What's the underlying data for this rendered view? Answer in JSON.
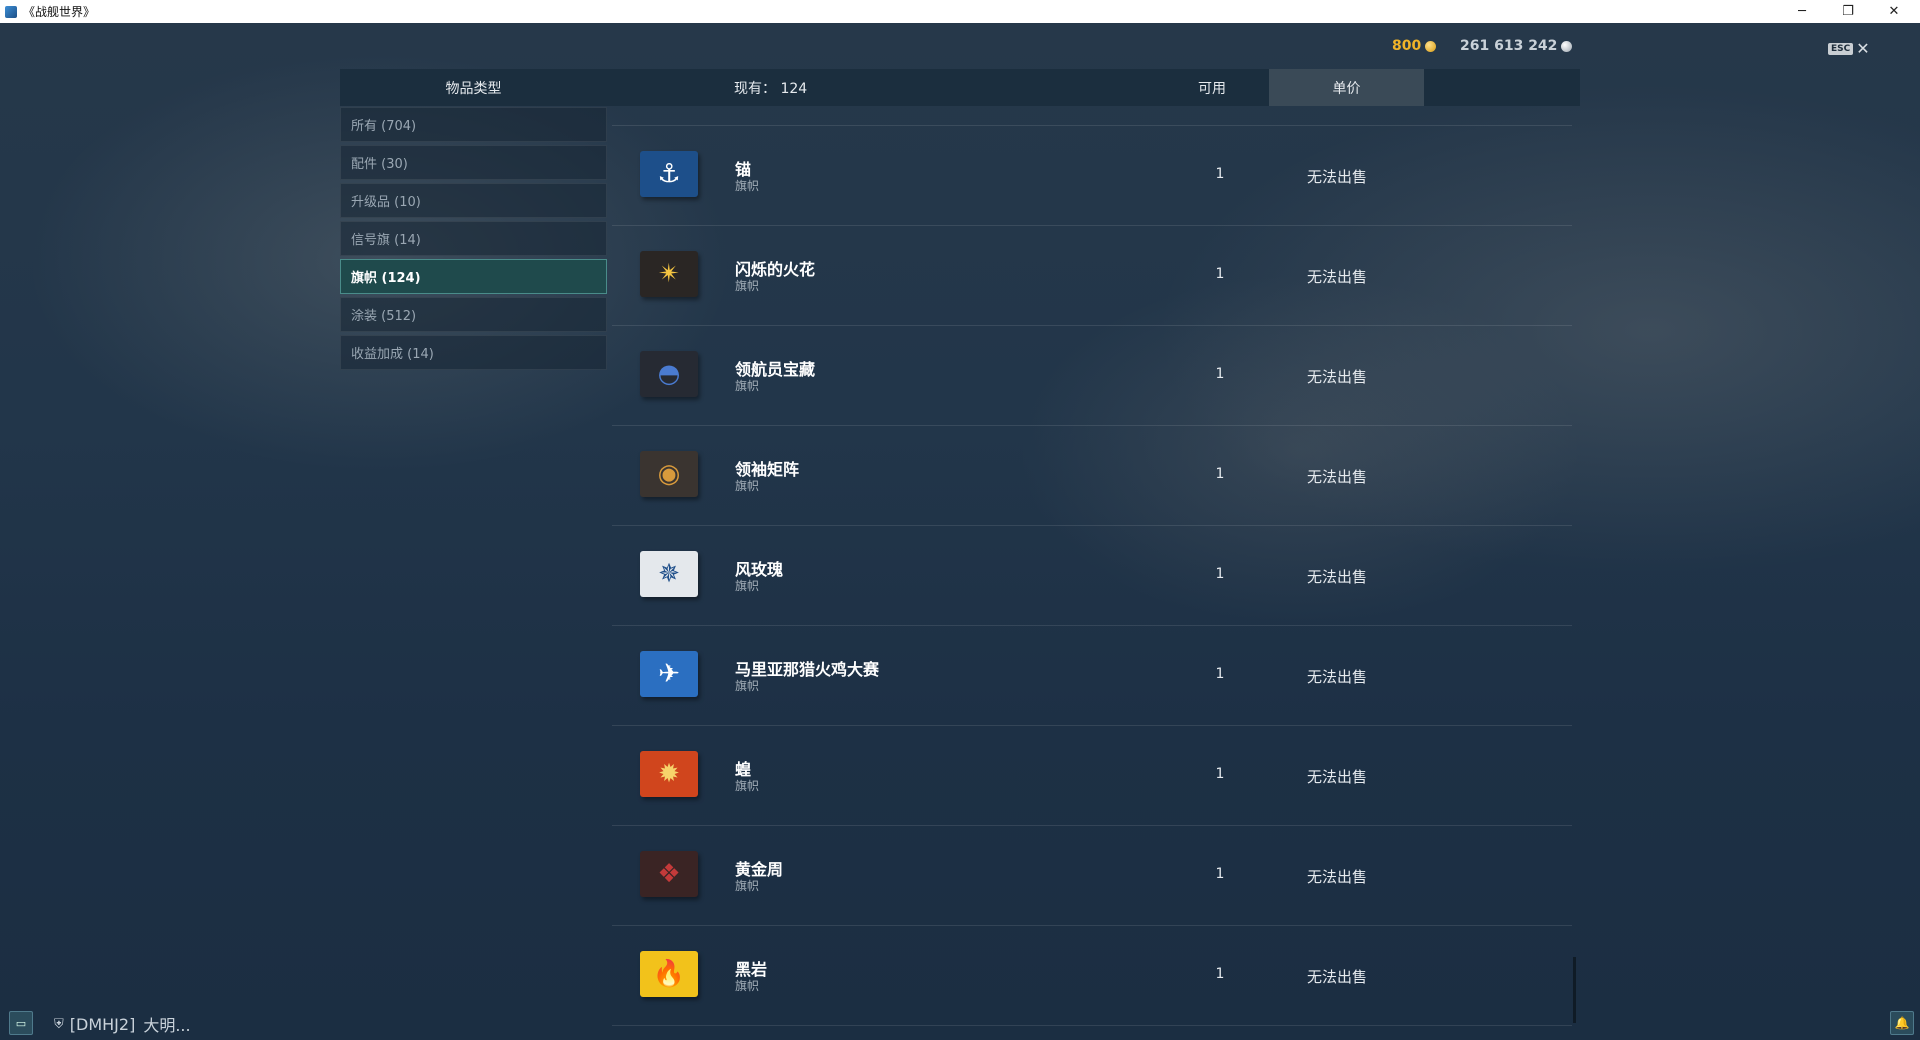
{
  "window": {
    "title": "《战舰世界》",
    "minimize": "─",
    "restore": "❐",
    "close": "✕"
  },
  "currencies": {
    "doubloons": "800",
    "doubloons_color": "#f0b429",
    "credits": "261 613 242",
    "credits_color": "#c9d1d8"
  },
  "esc": {
    "badge": "ESC",
    "close": "✕"
  },
  "header": {
    "type_label": "物品类型",
    "count_label": "现有：  124",
    "available_label": "可用",
    "price_label": "单价"
  },
  "categories": [
    {
      "label": "所有 (704)"
    },
    {
      "label": "配件 (30)"
    },
    {
      "label": "升级品 (10)"
    },
    {
      "label": "信号旗 (14)"
    },
    {
      "label": "旗帜 (124)",
      "active": true
    },
    {
      "label": "涂装 (512)"
    },
    {
      "label": "收益加成 (14)"
    }
  ],
  "items": [
    {
      "name": "锚",
      "type": "旗帜",
      "qty": "1",
      "price": "无法出售",
      "icon": "anchor-flag-icon",
      "glyph": "⚓",
      "bg": "#1d4f8a",
      "fg": "#ffffff"
    },
    {
      "name": "闪烁的火花",
      "type": "旗帜",
      "qty": "1",
      "price": "无法出售",
      "icon": "sparkle-flag-icon",
      "glyph": "✴",
      "bg": "#2a2624",
      "fg": "#f5c542"
    },
    {
      "name": "领航员宝藏",
      "type": "旗帜",
      "qty": "1",
      "price": "无法出售",
      "icon": "navigator-treasure-flag-icon",
      "glyph": "◓",
      "bg": "#262a33",
      "fg": "#4a7bd1"
    },
    {
      "name": "领袖矩阵",
      "type": "旗帜",
      "qty": "1",
      "price": "无法出售",
      "icon": "leader-matrix-flag-icon",
      "glyph": "◉",
      "bg": "#3a3430",
      "fg": "#d89a3c"
    },
    {
      "name": "风玫瑰",
      "type": "旗帜",
      "qty": "1",
      "price": "无法出售",
      "icon": "compass-rose-flag-icon",
      "glyph": "✵",
      "bg": "#e4e8ec",
      "fg": "#1f4f8a"
    },
    {
      "name": "马里亚那猎火鸡大赛",
      "type": "旗帜",
      "qty": "1",
      "price": "无法出售",
      "icon": "mariana-turkey-shoot-flag-icon",
      "glyph": "✈",
      "bg": "#2b6fc1",
      "fg": "#ffffff"
    },
    {
      "name": "蝗",
      "type": "旗帜",
      "qty": "1",
      "price": "无法出售",
      "icon": "locust-flag-icon",
      "glyph": "✹",
      "bg": "#d0451d",
      "fg": "#f7d36b"
    },
    {
      "name": "黄金周",
      "type": "旗帜",
      "qty": "1",
      "price": "无法出售",
      "icon": "golden-week-flag-icon",
      "glyph": "❖",
      "bg": "#3a2424",
      "fg": "#c43a3a"
    },
    {
      "name": "黑岩",
      "type": "旗帜",
      "qty": "1",
      "price": "无法出售",
      "icon": "black-rock-flag-icon",
      "glyph": "🔥",
      "bg": "#f2c21b",
      "fg": "#e0361b"
    }
  ],
  "bottom": {
    "chat_icon": "chat-icon",
    "clan_tag": "[DMHJ2]",
    "player": "大明..."
  }
}
